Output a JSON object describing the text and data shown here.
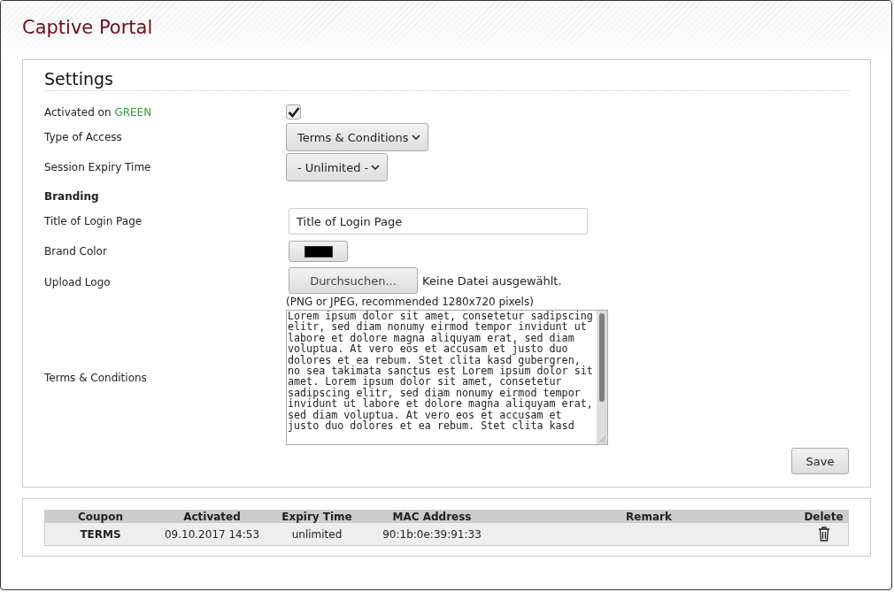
{
  "page_title": "Captive Portal",
  "settings": {
    "title": "Settings",
    "rows": [
      {
        "kind": "checkbox",
        "label": "Activated on ",
        "label_accent": "GREEN",
        "checked": true
      },
      {
        "kind": "select",
        "label": "Type of Access",
        "value": "Terms & Conditions"
      },
      {
        "kind": "select",
        "label": "Session Expiry Time",
        "value": "- Unlimited -"
      },
      {
        "kind": "heading",
        "label": "Branding"
      },
      {
        "kind": "text",
        "label": "Title of Login Page",
        "value": "Title of Login Page"
      },
      {
        "kind": "color",
        "label": "Brand Color",
        "color": "#000000"
      },
      {
        "kind": "file",
        "label": "Upload Logo",
        "button": "Durchsuchen...",
        "status": "Keine Datei ausgewählt.",
        "hint": "(PNG or JPEG, recommended 1280x720 pixels)"
      },
      {
        "kind": "textarea",
        "label": "Terms & Conditions",
        "value": "Lorem ipsum dolor sit amet, consetetur sadipscing elitr, sed diam nonumy eirmod tempor invidunt ut labore et dolore magna aliquyam erat, sed diam voluptua. At vero eos et accusam et justo duo dolores et ea rebum. Stet clita kasd gubergren, no sea takimata sanctus est Lorem ipsum dolor sit amet. Lorem ipsum dolor sit amet, consetetur sadipscing elitr, sed diam nonumy eirmod tempor invidunt ut labore et dolore magna aliquyam erat, sed diam voluptua. At vero eos et accusam et justo duo dolores et ea rebum. Stet clita kasd"
      }
    ],
    "save": "Save"
  },
  "coupons": {
    "columns": [
      "Coupon",
      "Activated",
      "Expiry Time",
      "MAC Address",
      "Remark",
      "Delete"
    ],
    "rows": [
      {
        "coupon": "TERMS",
        "activated": "09.10.2017 14:53",
        "expiry": "unlimited",
        "mac": "90:1b:0e:39:91:33"
      }
    ]
  }
}
